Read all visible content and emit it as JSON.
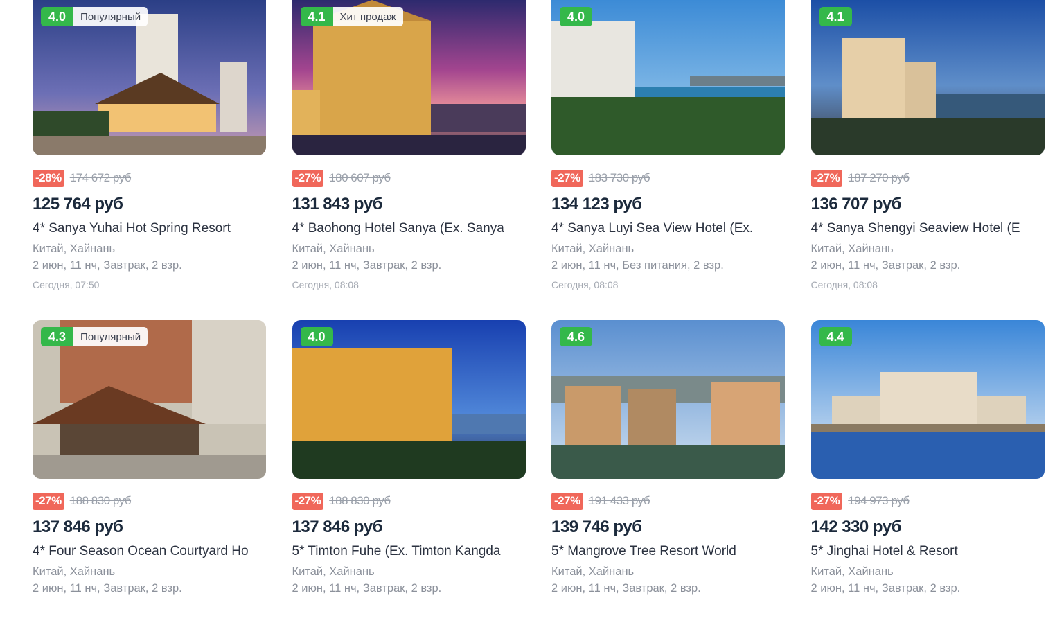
{
  "hotels": [
    {
      "rating": "4.0",
      "tag": "Популярный",
      "discount": "-28%",
      "old_price": "174 672 руб",
      "price": "125 764 руб",
      "name": "4* Sanya Yuhai Hot Spring Resort",
      "location": "Китай, Хайнань",
      "details": "2 июн, 11 нч, Завтрак, 2 взр.",
      "time": "Сегодня, 07:50"
    },
    {
      "rating": "4.1",
      "tag": "Хит продаж",
      "discount": "-27%",
      "old_price": "180 607 руб",
      "price": "131 843 руб",
      "name": "4* Baohong Hotel Sanya (Ex. Sanya",
      "location": "Китай, Хайнань",
      "details": "2 июн, 11 нч, Завтрак, 2 взр.",
      "time": "Сегодня, 08:08"
    },
    {
      "rating": "4.0",
      "tag": "",
      "discount": "-27%",
      "old_price": "183 730 руб",
      "price": "134 123 руб",
      "name": "4* Sanya Luyi Sea View Hotel (Ex.",
      "location": "Китай, Хайнань",
      "details": "2 июн, 11 нч, Без питания, 2 взр.",
      "time": "Сегодня, 08:08"
    },
    {
      "rating": "4.1",
      "tag": "",
      "discount": "-27%",
      "old_price": "187 270 руб",
      "price": "136 707 руб",
      "name": "4* Sanya Shengyi Seaview Hotel (E",
      "location": "Китай, Хайнань",
      "details": "2 июн, 11 нч, Завтрак, 2 взр.",
      "time": "Сегодня, 08:08"
    },
    {
      "rating": "4.3",
      "tag": "Популярный",
      "discount": "-27%",
      "old_price": "188 830 руб",
      "price": "137 846 руб",
      "name": "4* Four Season Ocean Courtyard Ho",
      "location": "Китай, Хайнань",
      "details": "2 июн, 11 нч, Завтрак, 2 взр.",
      "time": ""
    },
    {
      "rating": "4.0",
      "tag": "",
      "discount": "-27%",
      "old_price": "188 830 руб",
      "price": "137 846 руб",
      "name": "5* Timton Fuhe (Ex. Timton Kangda",
      "location": "Китай, Хайнань",
      "details": "2 июн, 11 нч, Завтрак, 2 взр.",
      "time": ""
    },
    {
      "rating": "4.6",
      "tag": "",
      "discount": "-27%",
      "old_price": "191 433 руб",
      "price": "139 746 руб",
      "name": "5* Mangrove Tree Resort World",
      "location": "Китай, Хайнань",
      "details": "2 июн, 11 нч, Завтрак, 2 взр.",
      "time": ""
    },
    {
      "rating": "4.4",
      "tag": "",
      "discount": "-27%",
      "old_price": "194 973 руб",
      "price": "142 330 руб",
      "name": "5* Jinghai Hotel & Resort",
      "location": "Китай, Хайнань",
      "details": "2 июн, 11 нч, Завтрак, 2 взр.",
      "time": ""
    }
  ],
  "colors": {
    "rating_bg": "#34b84a",
    "discount_bg": "#f0675a",
    "price": "#1c2a3c"
  }
}
